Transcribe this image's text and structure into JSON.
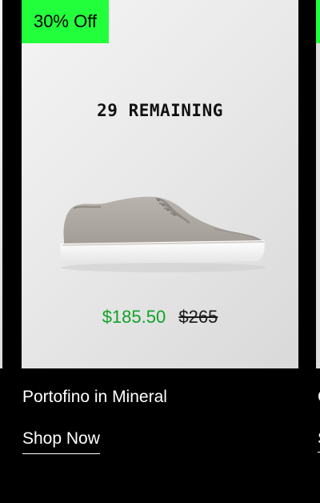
{
  "product": {
    "badge": "30% Off",
    "remaining": "29 REMAINING",
    "sale_price": "$185.50",
    "original_price": "$265",
    "title": "Portofino in Mineral",
    "cta": "Shop Now",
    "image_alt": "grey suede sneaker with white sole"
  },
  "next_product": {
    "title": "C",
    "cta": "S"
  },
  "colors": {
    "badge": "#22ff3b",
    "sale_price": "#0fa326",
    "background": "#000000"
  }
}
